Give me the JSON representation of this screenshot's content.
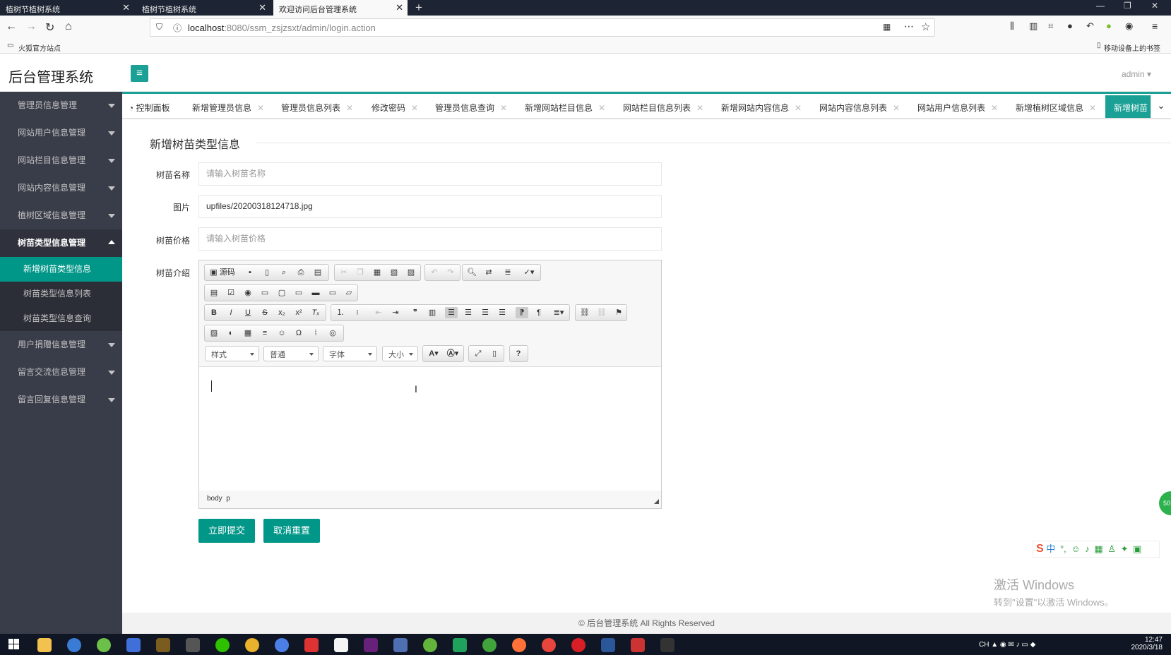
{
  "browser": {
    "tabs": [
      {
        "label": "植树节植树系统",
        "active": false
      },
      {
        "label": "植树节植树系统",
        "active": false
      },
      {
        "label": "欢迎访问后台管理系统",
        "active": true
      }
    ],
    "url_host": "localhost",
    "url_rest": ":8080/ssm_zsjzsxt/admin/login.action",
    "bookmark_left": "火狐官方站点",
    "bookmark_right": "移动设备上的书签"
  },
  "header": {
    "title": "后台管理系统",
    "user": "admin"
  },
  "sidebar": {
    "items": [
      {
        "label": "管理员信息管理"
      },
      {
        "label": "网站用户信息管理"
      },
      {
        "label": "网站栏目信息管理"
      },
      {
        "label": "网站内容信息管理"
      },
      {
        "label": "植树区域信息管理"
      },
      {
        "label": "树苗类型信息管理"
      },
      {
        "label": "用户捐赠信息管理"
      },
      {
        "label": "留言交流信息管理"
      },
      {
        "label": "留言回复信息管理"
      }
    ],
    "subitems": [
      {
        "label": "新增树苗类型信息"
      },
      {
        "label": "树苗类型信息列表"
      },
      {
        "label": "树苗类型信息查询"
      }
    ]
  },
  "tabs": [
    {
      "label": "控制面板"
    },
    {
      "label": "新增管理员信息"
    },
    {
      "label": "管理员信息列表"
    },
    {
      "label": "修改密码"
    },
    {
      "label": "管理员信息查询"
    },
    {
      "label": "新增网站栏目信息"
    },
    {
      "label": "网站栏目信息列表"
    },
    {
      "label": "新增网站内容信息"
    },
    {
      "label": "网站内容信息列表"
    },
    {
      "label": "网站用户信息列表"
    },
    {
      "label": "新增植树区域信息"
    },
    {
      "label": "新增树苗"
    }
  ],
  "form": {
    "title": "新增树苗类型信息",
    "name_label": "树苗名称",
    "name_placeholder": "请输入树苗名称",
    "image_label": "图片",
    "image_value": "upfiles/20200318124718.jpg",
    "price_label": "树苗价格",
    "price_placeholder": "请输入树苗价格",
    "intro_label": "树苗介绍",
    "submit": "立即提交",
    "reset": "取消重置"
  },
  "editor": {
    "source_label": "源码",
    "combo_style": "样式",
    "combo_format": "普通",
    "combo_font": "字体",
    "combo_size": "大小",
    "path_body": "body",
    "path_p": "p",
    "help": "?"
  },
  "footer": "© 后台管理系统 All Rights Reserved",
  "watermark": {
    "line1": "激活 Windows",
    "line2": "转到\"设置\"以激活 Windows。"
  },
  "ime": {
    "lang": "中",
    "badge": "50"
  },
  "clock": {
    "time": "12:47",
    "date": "2020/3/18"
  },
  "colors": {
    "accent": "#009688",
    "sidebar": "#393d49",
    "tab_active": "#1aa094"
  }
}
